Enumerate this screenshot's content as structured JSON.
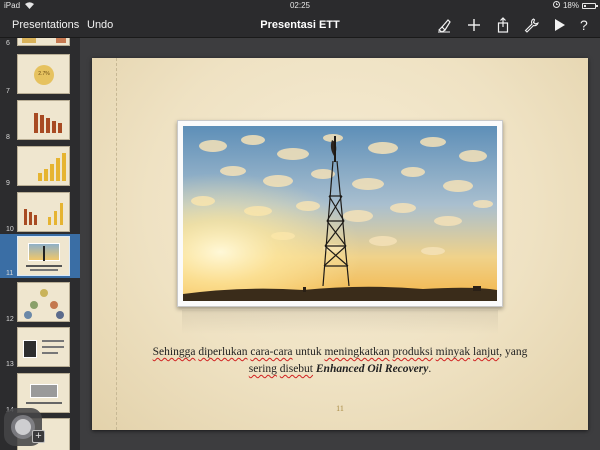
{
  "status_bar": {
    "device": "iPad",
    "time": "02:25",
    "battery": "18%"
  },
  "toolbar": {
    "presentations_label": "Presentations",
    "undo_label": "Undo",
    "title": "Presentasi ETT",
    "icons": [
      "paintbrush-icon",
      "plus-icon",
      "share-icon",
      "wrench-icon",
      "play-icon",
      "help-icon"
    ],
    "help_label": "?"
  },
  "sidebar": {
    "slides": [
      {
        "num": "6"
      },
      {
        "num": "7",
        "label": "2.7%"
      },
      {
        "num": "8"
      },
      {
        "num": "9"
      },
      {
        "num": "10"
      },
      {
        "num": "11",
        "selected": true
      },
      {
        "num": "12"
      },
      {
        "num": "13"
      },
      {
        "num": "14"
      }
    ],
    "add_label": "+"
  },
  "slide": {
    "caption_parts": [
      {
        "text": "Sehingga",
        "spell": true
      },
      {
        "text": " "
      },
      {
        "text": "diperlukan",
        "spell": true
      },
      {
        "text": " "
      },
      {
        "text": "cara-cara",
        "spell": true
      },
      {
        "text": " untuk "
      },
      {
        "text": "meningkatkan",
        "spell": true
      },
      {
        "text": " "
      },
      {
        "text": "produksi",
        "spell": true
      },
      {
        "text": " "
      },
      {
        "text": "minyak",
        "spell": true
      },
      {
        "text": " "
      },
      {
        "text": "lanjut",
        "spell": true
      },
      {
        "text": ", yang "
      },
      {
        "text": "sering",
        "spell": true
      },
      {
        "text": " "
      },
      {
        "text": "disebut",
        "spell": true
      },
      {
        "text": " "
      },
      {
        "text": "Enhanced Oil Recovery",
        "em": true
      },
      {
        "text": "."
      }
    ],
    "page_number": "11"
  },
  "colors": {
    "selection": "#3a6ea5",
    "toolbar": "#2b2b2d",
    "slide_bg": "#efe2c3"
  }
}
